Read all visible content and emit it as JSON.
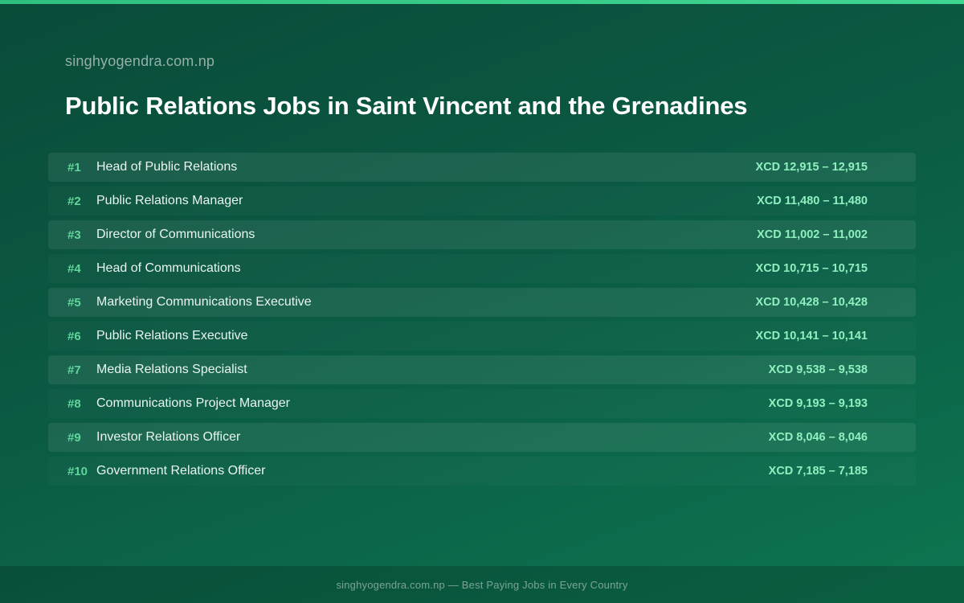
{
  "header": {
    "site_name": "singhyogendra.com.np",
    "title": "Public Relations Jobs in Saint Vincent and the Grenadines"
  },
  "jobs": [
    {
      "rank": "#1",
      "title": "Head of Public Relations",
      "salary": "XCD 12,915 – 12,915"
    },
    {
      "rank": "#2",
      "title": "Public Relations Manager",
      "salary": "XCD 11,480 – 11,480"
    },
    {
      "rank": "#3",
      "title": "Director of Communications",
      "salary": "XCD 11,002 – 11,002"
    },
    {
      "rank": "#4",
      "title": "Head of Communications",
      "salary": "XCD 10,715 – 10,715"
    },
    {
      "rank": "#5",
      "title": "Marketing Communications Executive",
      "salary": "XCD 10,428 – 10,428"
    },
    {
      "rank": "#6",
      "title": "Public Relations Executive",
      "salary": "XCD 10,141 – 10,141"
    },
    {
      "rank": "#7",
      "title": "Media Relations Specialist",
      "salary": "XCD 9,538 – 9,538"
    },
    {
      "rank": "#8",
      "title": "Communications Project Manager",
      "salary": "XCD 9,193 – 9,193"
    },
    {
      "rank": "#9",
      "title": "Investor Relations Officer",
      "salary": "XCD 8,046 – 8,046"
    },
    {
      "rank": "#10",
      "title": "Government Relations Officer",
      "salary": "XCD 7,185 – 7,185"
    }
  ],
  "footer": {
    "text": "singhyogendra.com.np — Best Paying Jobs in Every Country"
  },
  "colors": {
    "background": "#0b5a44",
    "accent_bar": "#3fd692",
    "rank": "#5fd69a",
    "salary": "#8ff0bf"
  }
}
